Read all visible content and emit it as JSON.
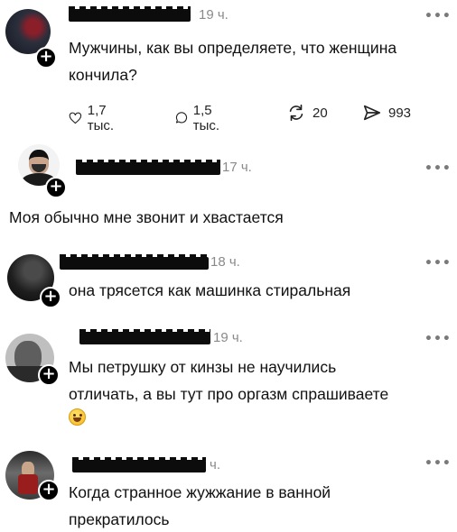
{
  "posts": [
    {
      "username": "",
      "time": "19 ч.",
      "more": "•••",
      "lines": [
        "Мужчины, как вы определяете, что женщина",
        "кончила?"
      ],
      "actions": {
        "likes": "1,7 тыс.",
        "comments": "1,5 тыс.",
        "reposts": "20",
        "shares": "993"
      }
    },
    {
      "username": "",
      "time": "17 ч.",
      "more": "•••",
      "lines": [
        "Моя обычно мне звонит и хвастается"
      ]
    },
    {
      "username": "",
      "time": "18 ч.",
      "more": "•••",
      "lines": [
        "она трясется как машинка стиральная"
      ]
    },
    {
      "username": "",
      "time": "19 ч.",
      "more": "•••",
      "lines": [
        "Мы петрушку от кинзы не научились",
        "отличать, а вы тут про оргазм спрашиваете"
      ],
      "emoji": "grinning-sweat-emoji"
    },
    {
      "username": "",
      "time": "ч.",
      "more": "•••",
      "lines": [
        "Когда странное жужжание в ванной",
        "прекратилось"
      ]
    }
  ],
  "plus_glyph": "+"
}
